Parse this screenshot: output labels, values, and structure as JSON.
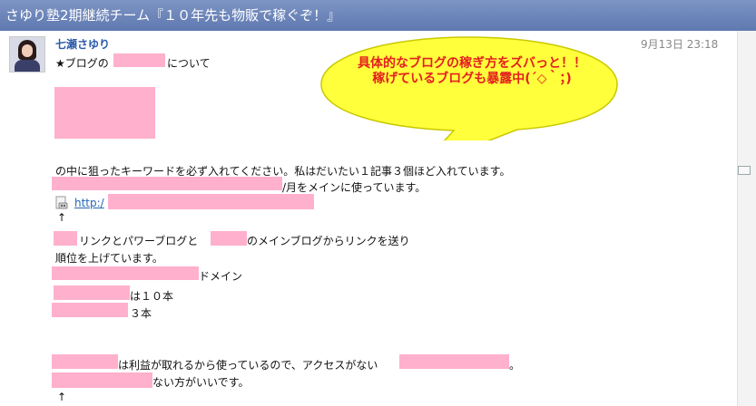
{
  "header": {
    "title": "さゆり塾2期継続チーム『１０年先も物販で稼ぐぞ！』"
  },
  "post": {
    "author": "七瀬さゆり",
    "date": "9月13日 23:18",
    "lines": {
      "l1": "★ブログの",
      "l1b": "について",
      "l2": "の中に狙ったキーワードを必ず入れてください。私はだいたい１記事３個ほど入れています。",
      "l3": "/月をメインに使っています。",
      "link": "http:/",
      "arrow1": "↑",
      "l4a": "リンクとパワーブログと",
      "l4b": "のメインブログからリンクを送り",
      "l5": "順位を上げています。",
      "l6": "ドメイン",
      "l7": "は１０本",
      "l8": "３本",
      "l9a": "は利益が取れるから使っているので、アクセスがない",
      "l9b": "。",
      "l10": "ない方がいいです。",
      "arrow2": "↑"
    }
  },
  "callout": {
    "line1": "具体的なブログの稼ぎ方をズバっと！！",
    "line2": "稼げているブログも暴露中(´◇｀；)",
    "color": "#e3201e",
    "fill": "#ffff3c"
  },
  "redaction_color": "#ffb0cd"
}
